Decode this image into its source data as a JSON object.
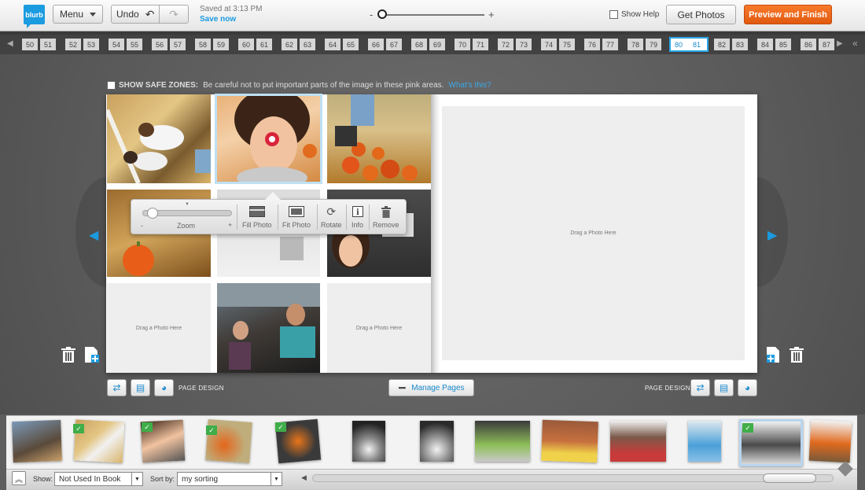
{
  "toolbar": {
    "logo": "blurb",
    "menu_label": "Menu",
    "undo_label": "Undo",
    "saved_text": "Saved at 3:13 PM",
    "save_now": "Save now",
    "zoom_minus": "-",
    "zoom_plus": "+",
    "show_help": "Show Help",
    "get_photos": "Get Photos",
    "preview": "Preview and Finish"
  },
  "page_strip": {
    "groups": [
      [
        "50",
        "51"
      ],
      [
        "52",
        "53"
      ],
      [
        "54",
        "55"
      ],
      [
        "56",
        "57"
      ],
      [
        "58",
        "59"
      ],
      [
        "60",
        "61"
      ],
      [
        "62",
        "63"
      ],
      [
        "64",
        "65"
      ],
      [
        "66",
        "67"
      ],
      [
        "68",
        "69"
      ],
      [
        "70",
        "71"
      ],
      [
        "72",
        "73"
      ],
      [
        "74",
        "75"
      ],
      [
        "76",
        "77"
      ],
      [
        "78",
        "79"
      ],
      [
        "80",
        "81"
      ],
      [
        "82",
        "83"
      ],
      [
        "84",
        "85"
      ],
      [
        "86",
        "87"
      ]
    ],
    "active_group": 15
  },
  "safe_zones": {
    "label": "SHOW SAFE ZONES:",
    "text": "Be careful not to put important parts of the image in these pink areas.",
    "link": "What's this?"
  },
  "spread": {
    "left_empty_1": "Drag a Photo Here",
    "left_empty_2": "Drag a Photo Here",
    "right_empty": "Drag a Photo Here"
  },
  "popover": {
    "zoom_label": "Zoom",
    "zoom_min": "-",
    "zoom_max": "+",
    "fill_photo": "Fill Photo",
    "fit_photo": "Fit Photo",
    "rotate": "Rotate",
    "info": "Info",
    "remove": "Remove"
  },
  "page_tools": {
    "left_label": "PAGE DESIGN",
    "right_label": "PAGE DESIGN",
    "manage_pages": "Manage Pages"
  },
  "tray": {
    "show_label": "Show:",
    "show_value": "Not Used In Book",
    "sort_label": "Sort by:",
    "sort_value": "my sorting"
  },
  "colors": {
    "accent": "#1b9be0",
    "preview_orange": "#f0701f",
    "check_green": "#3fae49"
  }
}
